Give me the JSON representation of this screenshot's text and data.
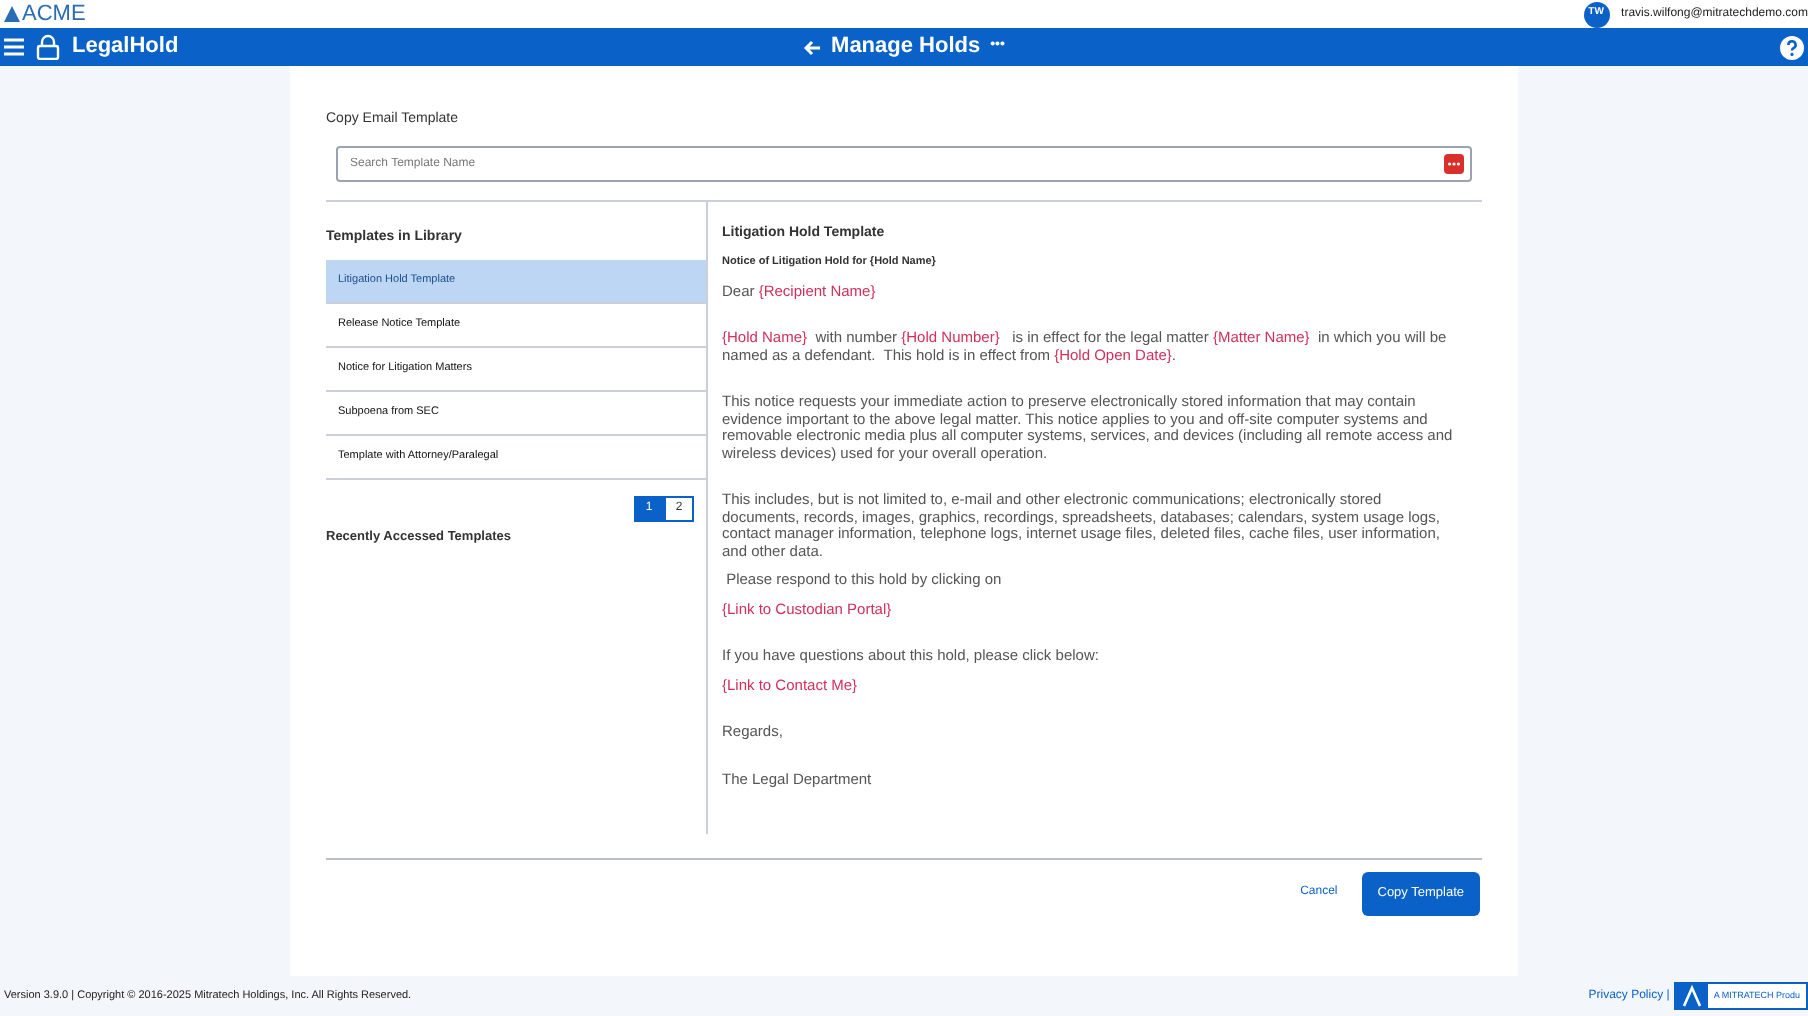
{
  "top_bar": {
    "logo": "ACME",
    "avatar_initials": "TW",
    "user_email": "travis.wilfong@mitratechdemo.com"
  },
  "nav_bar": {
    "app_name": "LegalHold",
    "page_title": "Manage Holds",
    "more": "•••"
  },
  "page": {
    "heading": "Copy Email Template",
    "search": {
      "placeholder": "Search Template Name"
    }
  },
  "library": {
    "heading": "Templates in Library",
    "items": [
      {
        "label": "Litigation Hold Template",
        "selected": true
      },
      {
        "label": "Release Notice Template",
        "selected": false
      },
      {
        "label": "Notice for Litigation Matters",
        "selected": false
      },
      {
        "label": "Subpoena from SEC",
        "selected": false
      },
      {
        "label": "Template with Attorney/Paralegal",
        "selected": false
      }
    ],
    "pages": [
      {
        "label": "1",
        "selected": true
      },
      {
        "label": "2",
        "selected": false
      }
    ],
    "recent_heading": "Recently Accessed Templates"
  },
  "preview": {
    "title": "Litigation Hold Template",
    "subject": "Notice of Litigation Hold for {Hold Name}",
    "blocks": [
      [
        [
          {
            "kind": "plain",
            "text": "Dear "
          },
          {
            "kind": "placeholder",
            "text": "{Recipient Name}"
          }
        ]
      ],
      [
        [
          {
            "kind": "placeholder",
            "text": "{Hold Name}"
          },
          {
            "kind": "plain",
            "text": "  with number "
          },
          {
            "kind": "placeholder",
            "text": "{Hold Number}"
          },
          {
            "kind": "plain",
            "text": "   is in effect for the legal matter "
          },
          {
            "kind": "placeholder",
            "text": "{Matter Name}"
          },
          {
            "kind": "plain",
            "text": "  in which you will be named as a defendant.  This hold is in effect from "
          },
          {
            "kind": "placeholder",
            "text": "{Hold Open Date}"
          },
          {
            "kind": "plain",
            "text": "."
          }
        ]
      ],
      [
        [
          {
            "kind": "plain",
            "text": "This notice requests your immediate action to preserve electronically stored information that may contain evidence important to the above legal matter. This notice applies to you and off-site computer systems and removable electronic media plus all computer systems, services, and devices (including all remote access and wireless devices) used for your overall operation."
          }
        ]
      ],
      [
        [
          {
            "kind": "plain",
            "text": "This includes, but is not limited to, e-mail and other electronic communications; electronically stored documents, records, images, graphics, recordings, spreadsheets, databases; calendars, system usage logs, contact manager information, telephone logs, internet usage files, deleted files, cache files, user information, and other data."
          }
        ],
        [
          {
            "kind": "plain",
            "text": " Please respond to this hold by clicking on"
          }
        ],
        [
          {
            "kind": "placeholder",
            "text": "{Link to Custodian Portal}"
          }
        ]
      ],
      [
        [
          {
            "kind": "plain",
            "text": "If you have questions about this hold, please click below:"
          }
        ],
        [
          {
            "kind": "placeholder",
            "text": "{Link to Contact Me}"
          }
        ]
      ],
      [
        [
          {
            "kind": "plain",
            "text": "Regards,"
          }
        ]
      ],
      [
        [
          {
            "kind": "plain",
            "text": "The Legal Department"
          }
        ]
      ]
    ]
  },
  "actions": {
    "cancel": "Cancel",
    "copy": "Copy Template"
  },
  "footer": {
    "copyright": "Version 3.9.0 | Copyright © 2016-2025 Mitratech Holdings, Inc. All Rights Reserved.",
    "privacy": "Privacy Policy |",
    "brand": "A MITRATECH Produ"
  }
}
